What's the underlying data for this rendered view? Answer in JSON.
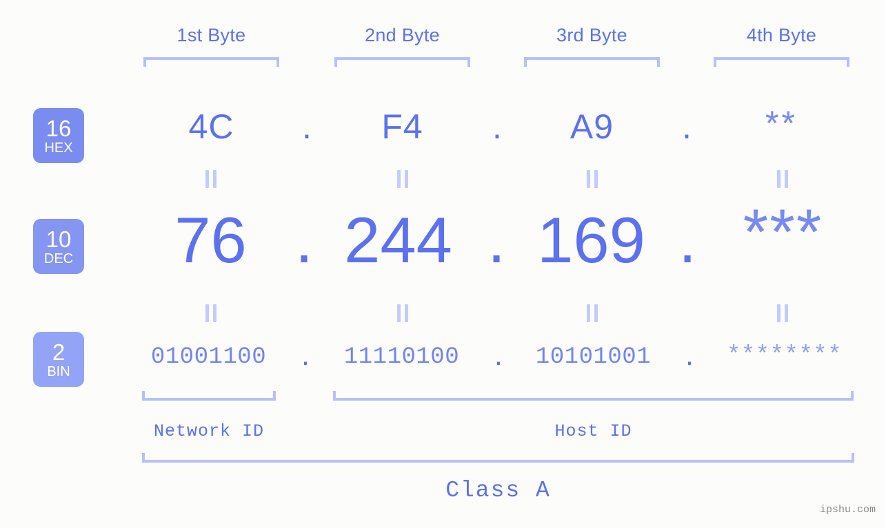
{
  "watermark": "ipshu.com",
  "byte_headers": [
    {
      "label": "1st Byte"
    },
    {
      "label": "2nd Byte"
    },
    {
      "label": "3rd Byte"
    },
    {
      "label": "4th Byte"
    }
  ],
  "bases": [
    {
      "num": "16",
      "name": "HEX",
      "color": "#7b8cf0"
    },
    {
      "num": "10",
      "name": "DEC",
      "color": "#8596f2"
    },
    {
      "num": "2",
      "name": "BIN",
      "color": "#93a4f7"
    }
  ],
  "separator": ".",
  "equality_symbol": "||",
  "rows": {
    "hex": {
      "base_label": "HEX",
      "base_num": "16",
      "values": [
        "4C",
        "F4",
        "A9",
        "**"
      ]
    },
    "dec": {
      "base_label": "DEC",
      "base_num": "10",
      "values": [
        "76",
        "244",
        "169",
        "***"
      ]
    },
    "bin": {
      "base_label": "BIN",
      "base_num": "2",
      "values": [
        "01001100",
        "11110100",
        "10101001",
        "********"
      ]
    }
  },
  "segments": {
    "network_id": "Network ID",
    "host_id": "Host ID",
    "class": "Class A"
  },
  "colors": {
    "accent": "#5b71ef",
    "accent_light": "#b6c0fb",
    "badge_hex": "#7b8cf0",
    "badge_dec": "#8596f2",
    "badge_bin": "#93a4f7",
    "background": "#fcfdfa",
    "watermark": "#8a8a8a"
  }
}
